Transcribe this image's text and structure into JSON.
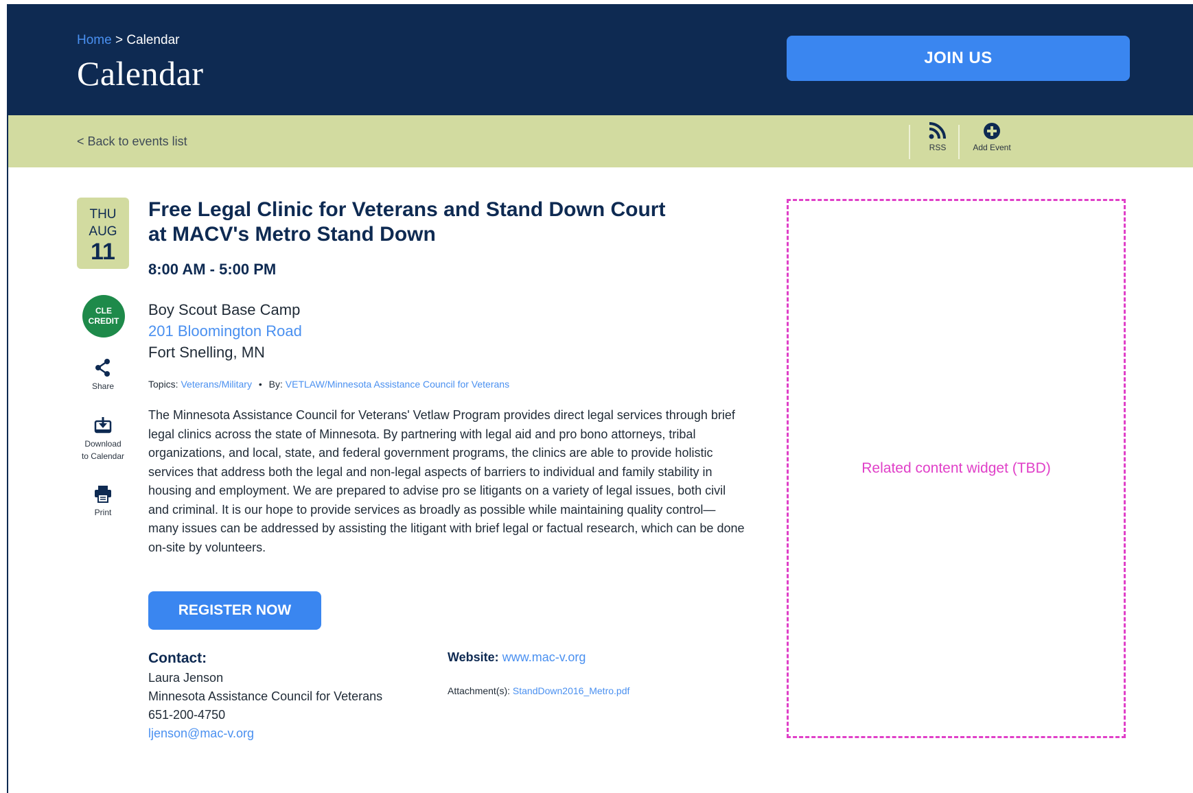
{
  "header": {
    "breadcrumb_home": "Home",
    "breadcrumb_sep": ">",
    "breadcrumb_current": "Calendar",
    "title": "Calendar",
    "join_label": "JOIN US"
  },
  "subbar": {
    "back_label": "< Back to events list",
    "rss_label": "RSS",
    "add_event_label": "Add Event"
  },
  "event": {
    "date": {
      "dow": "THU",
      "month": "AUG",
      "day": "11"
    },
    "title": "Free Legal Clinic for Veterans and Stand Down Court at MACV's Metro Stand Down",
    "time": "8:00 AM - 5:00 PM",
    "venue_name": "Boy Scout Base Camp",
    "venue_address": "201 Bloomington Road",
    "venue_city": "Fort Snelling, MN",
    "topics_label": "Topics:",
    "topics_value": "Veterans/Military",
    "by_label": "By:",
    "by_value": "VETLAW/Minnesota Assistance Council for Veterans",
    "description": "The Minnesota Assistance Council for Veterans' Vetlaw Program provides direct legal services through brief legal clinics across the state of Minnesota. By partnering with legal aid and pro bono attorneys, tribal organizations, and local, state, and federal government programs, the clinics are able to provide holistic services that address both the legal and non-legal aspects of barriers to individual and family stability in housing and employment. We are prepared to advise pro se litigants on a variety of legal issues, both civil and criminal. It is our hope to provide services as broadly as possible while maintaining quality control—many issues can be addressed by assisting the litigant with brief legal or factual research, which can be done on-site by volunteers.",
    "register_label": "REGISTER NOW"
  },
  "sidebar_tools": {
    "cle_line1": "CLE",
    "cle_line2": "CREDIT",
    "share_label": "Share",
    "download_line1": "Download",
    "download_line2": "to Calendar",
    "print_label": "Print"
  },
  "contact": {
    "label": "Contact:",
    "name": "Laura Jenson",
    "org": "Minnesota Assistance Council for Veterans",
    "phone": "651-200-4750",
    "email": "ljenson@mac-v.org"
  },
  "website": {
    "label": "Website:",
    "url": "www.mac-v.org"
  },
  "attachment": {
    "label": "Attachment(s):",
    "file": "StandDown2016_Metro.pdf"
  },
  "widget": {
    "label": "Related content widget (TBD)"
  },
  "colors": {
    "navy": "#0e2a52",
    "accent_blue": "#3a86f0",
    "link_blue": "#4a90f0",
    "olive_bar": "#d2dba0",
    "cle_green": "#1e8a4a",
    "widget_magenta": "#e040c8"
  }
}
